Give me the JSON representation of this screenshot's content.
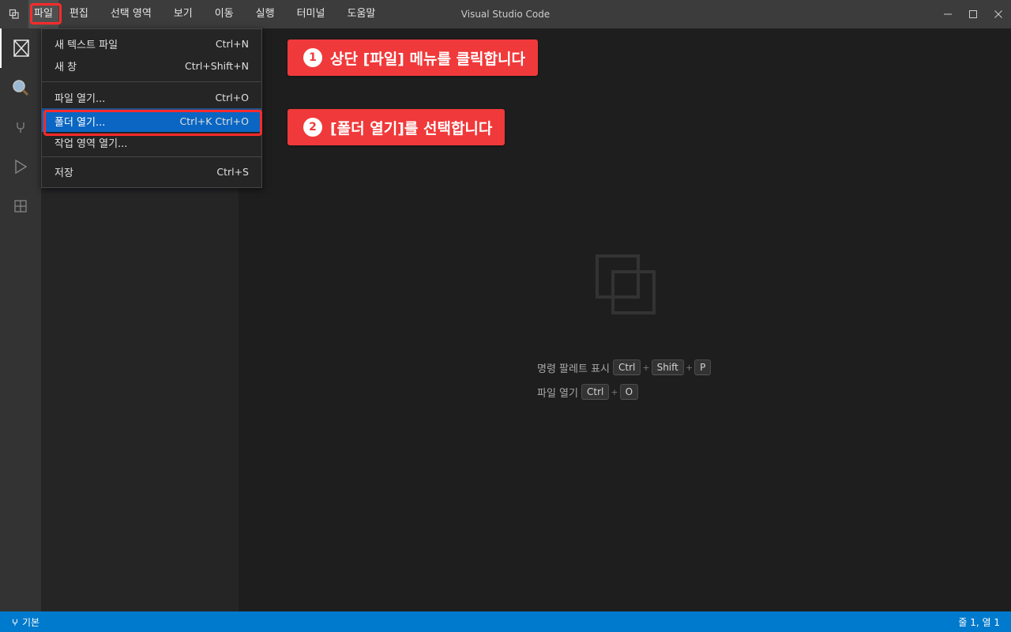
{
  "window": {
    "title": "Visual Studio Code"
  },
  "menubar": {
    "items": [
      "파일",
      "편집",
      "선택 영역",
      "보기",
      "이동",
      "실행",
      "터미널",
      "도움말"
    ]
  },
  "file_menu": {
    "items": [
      {
        "label": "새 텍스트 파일",
        "shortcut": "Ctrl+N"
      },
      {
        "label": "새 창",
        "shortcut": "Ctrl+Shift+N"
      },
      {
        "label": "파일 열기...",
        "shortcut": "Ctrl+O"
      },
      {
        "label": "폴더 열기...",
        "shortcut": "Ctrl+K Ctrl+O"
      },
      {
        "label": "작업 영역 열기...",
        "shortcut": ""
      },
      {
        "label": "저장",
        "shortcut": "Ctrl+S"
      }
    ],
    "highlighted": "폴더 열기..."
  },
  "annotations": [
    {
      "number": "1",
      "text": "상단 [파일] 메뉴를 클릭합니다"
    },
    {
      "number": "2",
      "text": "[폴더 열기]를 선택합니다"
    }
  ],
  "welcome": {
    "command_palette_label": "명령 팔레트 표시",
    "command_palette_keys": [
      "Ctrl",
      "Shift",
      "P"
    ],
    "open_file_label": "파일 열기",
    "open_file_keys": [
      "Ctrl",
      "O"
    ]
  },
  "statusbar": {
    "branch": "기본",
    "position": "줄 1, 열 1"
  },
  "colors": {
    "accent": "#007acc",
    "highlight": "#0a66c2",
    "annotation": "#f0393a"
  }
}
